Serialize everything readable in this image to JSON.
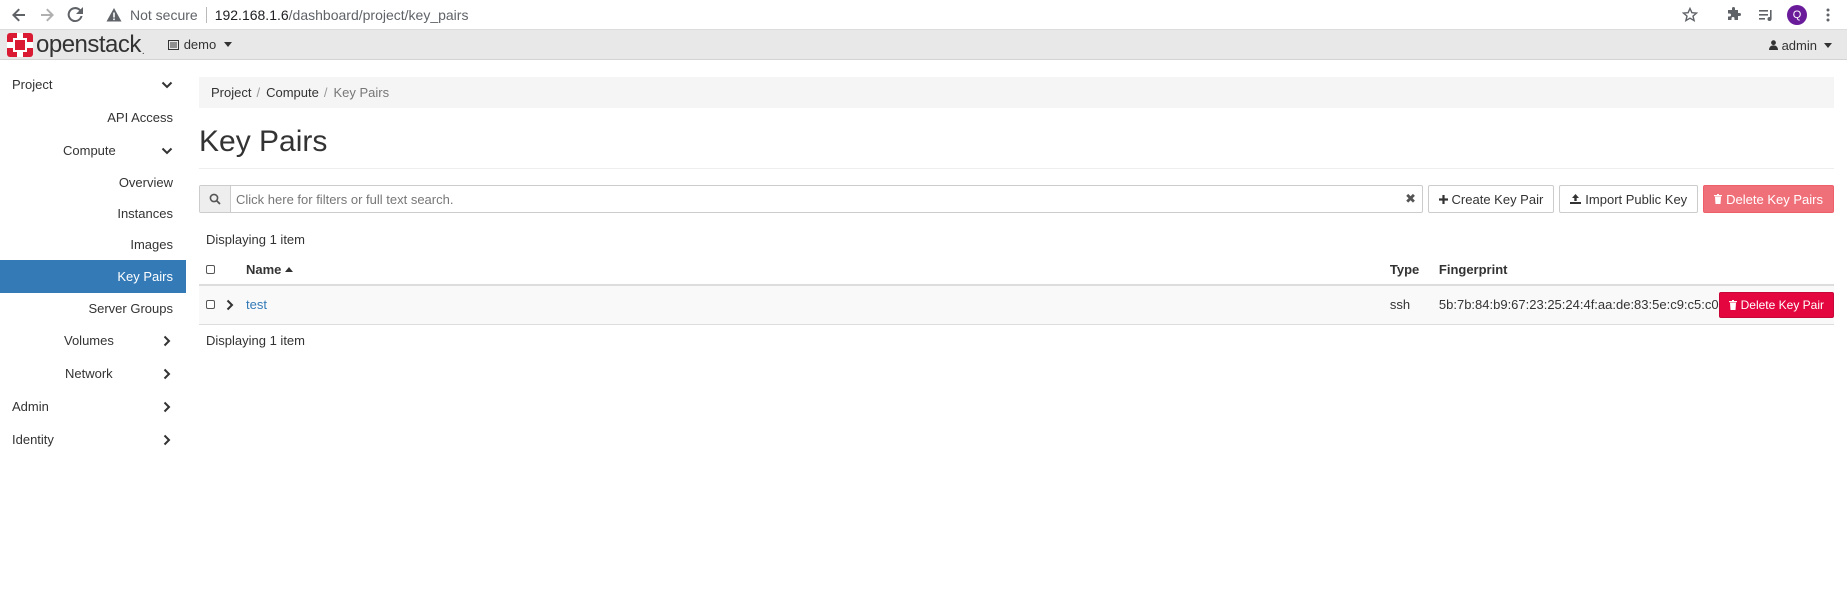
{
  "browser": {
    "security_label": "Not secure",
    "url_host": "192.168.1.6",
    "url_path": "/dashboard/project/key_pairs",
    "profile_initial": "Q"
  },
  "header": {
    "logo_text": "openstack",
    "logo_dot": ".",
    "project": "demo",
    "user": "admin",
    "brand_color": "#da1a32"
  },
  "sidebar": {
    "items": [
      {
        "label": "Project",
        "icon": "chevron-down-icon"
      },
      {
        "label": "API Access"
      },
      {
        "label": "Compute",
        "icon": "chevron-down-icon"
      },
      {
        "label": "Overview"
      },
      {
        "label": "Instances"
      },
      {
        "label": "Images"
      },
      {
        "label": "Key Pairs",
        "active": true
      },
      {
        "label": "Server Groups"
      },
      {
        "label": "Volumes",
        "icon": "chevron-right-icon"
      },
      {
        "label": "Network",
        "icon": "chevron-right-icon"
      },
      {
        "label": "Admin",
        "icon": "chevron-right-icon"
      },
      {
        "label": "Identity",
        "icon": "chevron-right-icon"
      }
    ]
  },
  "breadcrumb": {
    "items": [
      "Project",
      "Compute",
      "Key Pairs"
    ],
    "sep": "/"
  },
  "page": {
    "title": "Key Pairs"
  },
  "toolbar": {
    "search_placeholder": "Click here for filters or full text search.",
    "clear_glyph": "✖",
    "create_label": "Create Key Pair",
    "import_label": "Import Public Key",
    "delete_label": "Delete Key Pairs"
  },
  "table": {
    "displaying_text": "Displaying 1 item",
    "columns": {
      "name": "Name",
      "type": "Type",
      "fingerprint": "Fingerprint"
    },
    "rows": [
      {
        "name": "test",
        "type": "ssh",
        "fingerprint": "5b:7b:84:b9:67:23:25:24:4f:aa:de:83:5e:c9:c5:c0",
        "action_label": "Delete Key Pair"
      }
    ]
  }
}
